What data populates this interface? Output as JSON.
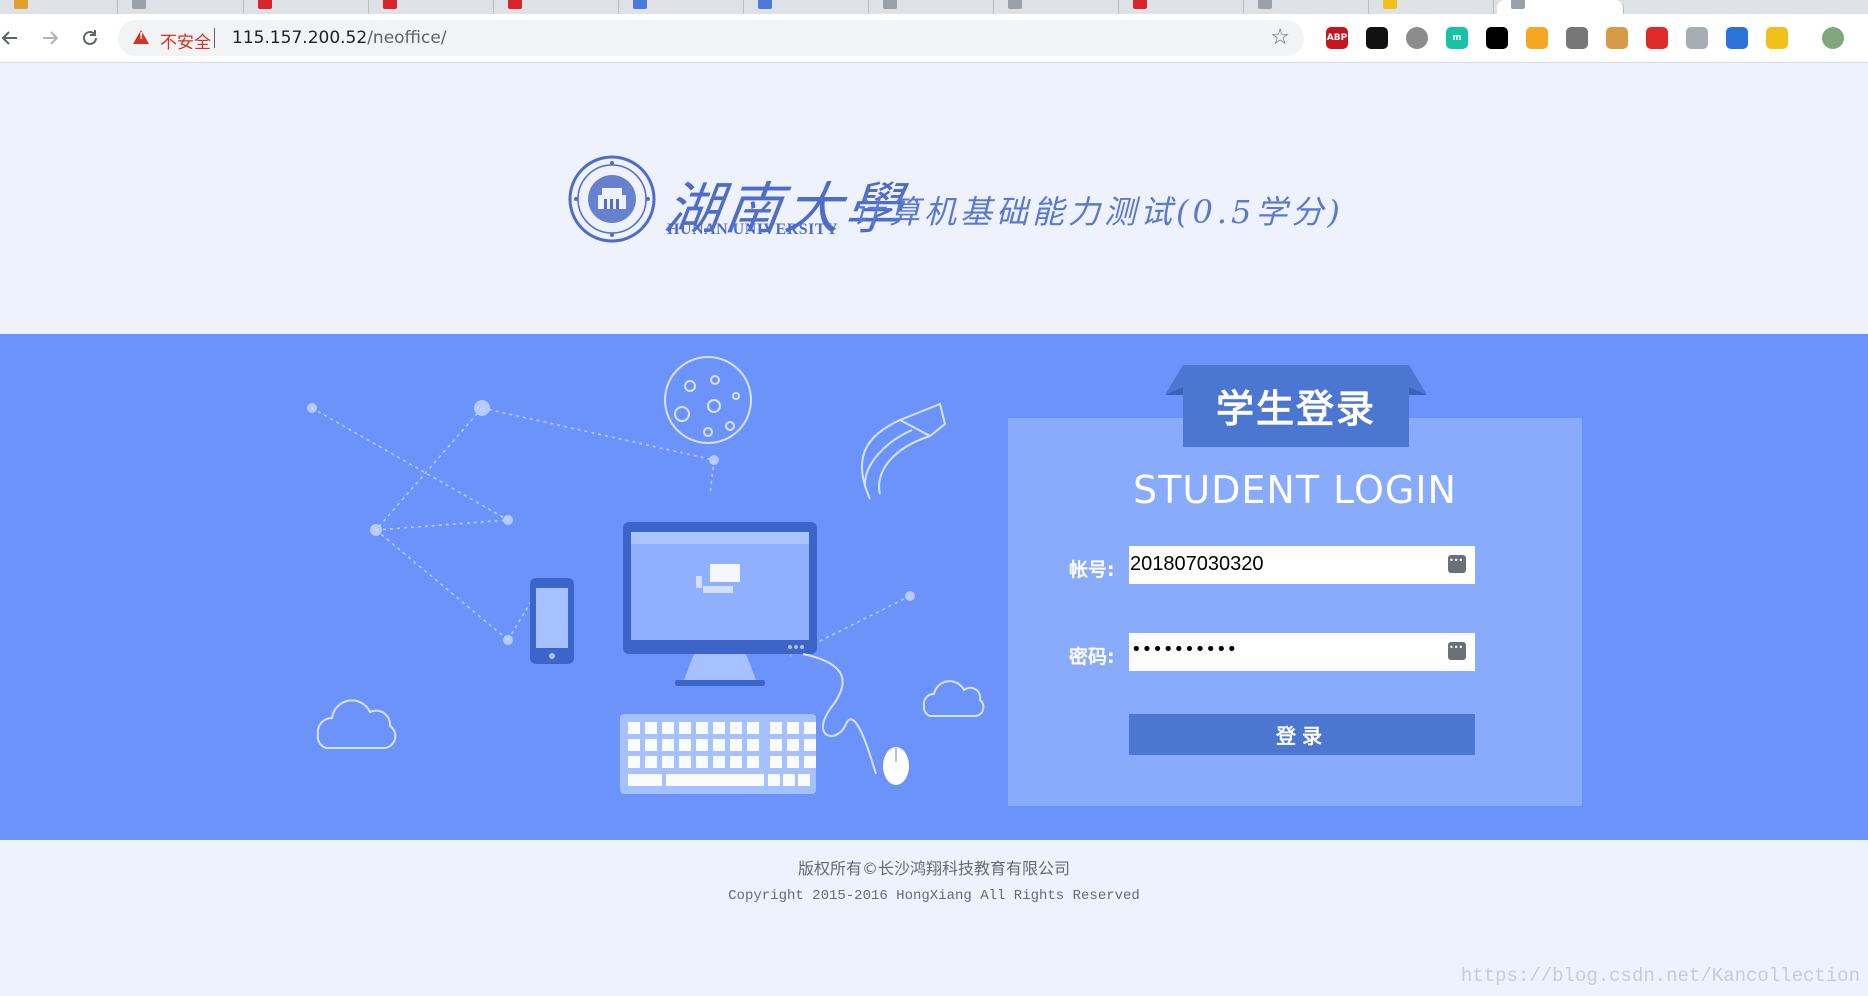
{
  "browser": {
    "insecure_label": "不安全",
    "url_host": "115.157.200.52",
    "url_path": "/neoffice/",
    "extensions": [
      {
        "name": "adblock-plus-icon",
        "label": "ABP",
        "color": "#c4161c"
      },
      {
        "name": "glasses-extension-icon",
        "label": "",
        "color": "#111111"
      },
      {
        "name": "circle-extension-icon",
        "label": "",
        "color": "#8c8c8c"
      },
      {
        "name": "m-extension-icon",
        "label": "m",
        "color": "#17c3a6"
      },
      {
        "name": "black-extension-icon",
        "label": "",
        "color": "#000000"
      },
      {
        "name": "play-extension-icon",
        "label": "",
        "color": "#f5a623"
      },
      {
        "name": "film-extension-icon",
        "label": "",
        "color": "#777777"
      },
      {
        "name": "cookie-extension-icon",
        "label": "",
        "color": "#d79a46"
      },
      {
        "name": "red-extension-icon",
        "label": "",
        "color": "#e02a2a"
      },
      {
        "name": "bird-extension-icon",
        "label": "",
        "color": "#a7acb3"
      },
      {
        "name": "blue-badge-extension-icon",
        "label": "",
        "color": "#2a73d9"
      },
      {
        "name": "yellow-extension-icon",
        "label": "",
        "color": "#f2c01a"
      },
      {
        "name": "avatar-extension-icon",
        "label": "",
        "color": "#7ea87b"
      }
    ]
  },
  "header": {
    "logo_cn": "湖南大學",
    "logo_en": "HUNAN UNIVERSITY",
    "subtitle": "计算机基础能力测试(0.5学分)"
  },
  "login": {
    "title_cn": "学生登录",
    "title_en": "STUDENT LOGIN",
    "account_label": "帐号:",
    "account_value": "201807030320",
    "password_label": "密码:",
    "password_mask": "••••••••••",
    "submit_label": "登录"
  },
  "footer": {
    "copyright_cn": "版权所有©长沙鸿翔科技教育有限公司",
    "copyright_en": "Copyright 2015-2016 HongXiang All Rights Reserved"
  },
  "watermark": "https://blog.csdn.net/Kancollection",
  "colors": {
    "banner": "#6b93fa",
    "panel": "#88abfb",
    "button": "#4c77d0",
    "logo": "#4f6dc6"
  }
}
